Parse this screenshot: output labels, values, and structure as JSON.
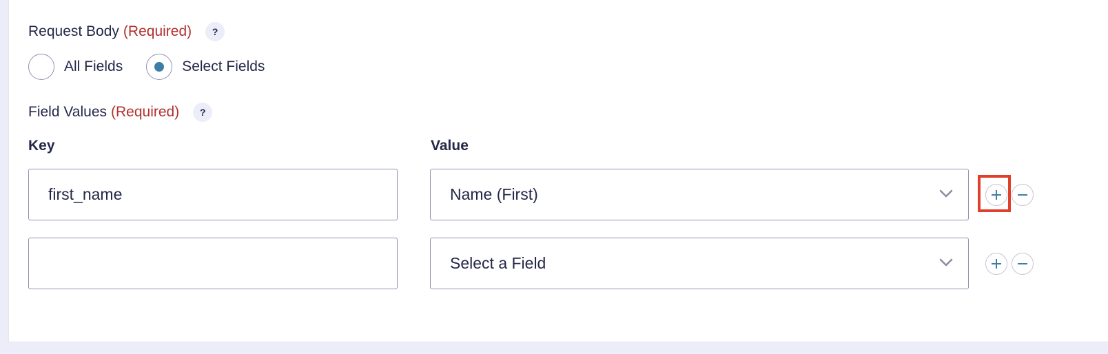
{
  "request_body": {
    "label": "Request Body",
    "required": "(Required)",
    "help": "?",
    "options": [
      {
        "label": "All Fields",
        "selected": false
      },
      {
        "label": "Select Fields",
        "selected": true
      }
    ]
  },
  "field_values": {
    "label": "Field Values",
    "required": "(Required)",
    "help": "?",
    "key_header": "Key",
    "value_header": "Value",
    "rows": [
      {
        "key": "first_name",
        "value": "Name (First)"
      },
      {
        "key": "",
        "value": "Select a Field"
      }
    ]
  },
  "colors": {
    "accent": "#3e7da6",
    "required": "#b3302d",
    "highlight": "#e0402a"
  }
}
